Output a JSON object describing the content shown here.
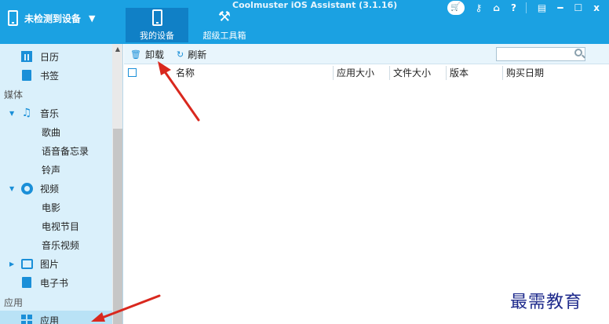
{
  "window": {
    "title": "Coolmuster iOS Assistant (3.1.16)",
    "device_selector": "未检测到设备",
    "controls": [
      "cart-icon",
      "key-icon",
      "home-icon",
      "help-icon",
      "feedback-icon",
      "minimize-icon",
      "maximize-icon",
      "close-icon"
    ],
    "controls_text": {
      "help": "?",
      "minimize": "━",
      "maximize": "☐",
      "close": "x"
    }
  },
  "nav_tabs": [
    {
      "label": "我的设备",
      "icon": "phone-icon",
      "active": true
    },
    {
      "label": "超级工具箱",
      "icon": "tools-icon",
      "active": false
    }
  ],
  "sidebar": {
    "items": [
      {
        "label": "日历",
        "icon": "calendar-icon"
      },
      {
        "label": "书签",
        "icon": "bookmark-icon"
      }
    ],
    "section_media": "媒体",
    "music": {
      "label": "音乐",
      "icon": "music-icon",
      "expander": "▼",
      "children": [
        "歌曲",
        "语音备忘录",
        "铃声"
      ]
    },
    "video": {
      "label": "视频",
      "icon": "video-icon",
      "expander": "▼",
      "children": [
        "电影",
        "电视节目",
        "音乐视频"
      ]
    },
    "photos": {
      "label": "图片",
      "icon": "photo-icon",
      "expander": "▶"
    },
    "ebooks": {
      "label": "电子书",
      "icon": "ebook-icon"
    },
    "section_apps": "应用",
    "apps": {
      "label": "应用",
      "icon": "apps-icon",
      "selected": true
    }
  },
  "toolbar": {
    "uninstall_label": "卸载",
    "refresh_label": "刷新",
    "search_placeholder": ""
  },
  "table": {
    "columns": [
      "名称",
      "应用大小",
      "文件大小",
      "版本",
      "购买日期"
    ],
    "rows": []
  },
  "watermark": "最需教育",
  "colors": {
    "titlebar": "#1ba1e2",
    "active_tab": "#1080c6",
    "sidebar_bg": "#daf0fb",
    "accent": "#1a8fd8",
    "annotation_arrow": "#d9281e"
  }
}
